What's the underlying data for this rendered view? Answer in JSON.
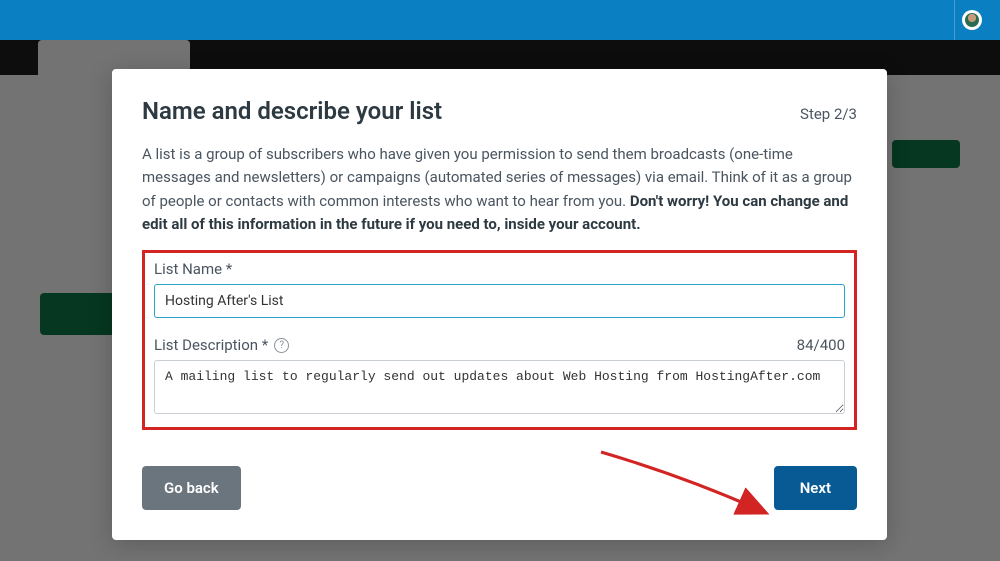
{
  "modal": {
    "title": "Name and describe your list",
    "step": "Step 2/3",
    "description_prefix": "A list is a group of subscribers who have given you permission to send them broadcasts (one-time messages and newsletters) or campaigns (automated series of messages) via email. Think of it as a group of people or contacts with common interests who want to hear from you. ",
    "description_bold": "Don't worry! You can change and edit all of this information in the future if you need to, inside your account.",
    "list_name_label": "List Name *",
    "list_name_value": "Hosting After's List",
    "list_desc_label": "List Description *",
    "list_desc_value": "A mailing list to regularly send out updates about Web Hosting from HostingAfter.com",
    "char_count": "84/400",
    "go_back_label": "Go back",
    "next_label": "Next"
  }
}
